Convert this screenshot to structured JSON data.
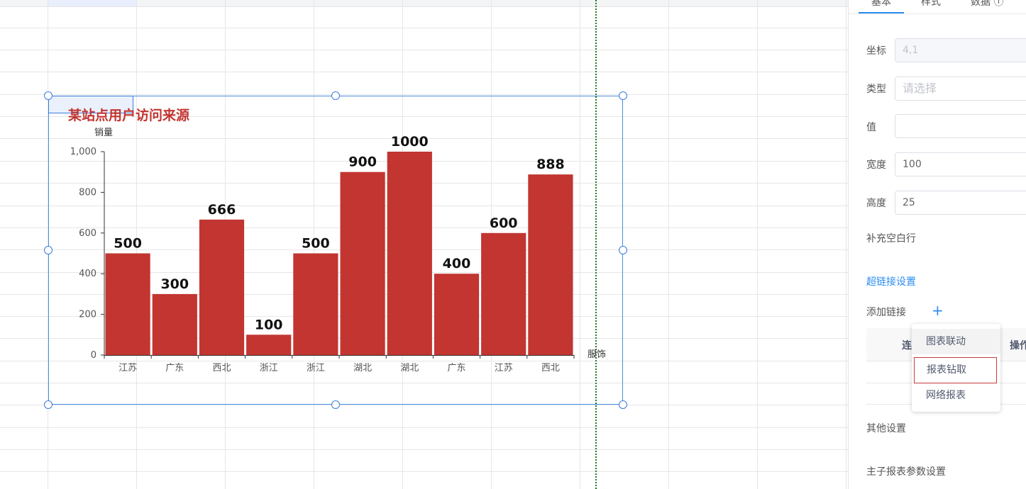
{
  "chart_data": {
    "type": "bar",
    "title": "某站点用户访问来源",
    "ylabel": "销量",
    "xlabel": "服饰",
    "categories": [
      "江苏",
      "广东",
      "西北",
      "浙江",
      "浙江",
      "湖北",
      "湖北",
      "广东",
      "江苏",
      "西北"
    ],
    "values": [
      500,
      300,
      666,
      100,
      500,
      900,
      1000,
      400,
      600,
      888
    ],
    "ylim": [
      0,
      1000
    ],
    "yticks": [
      "0",
      "200",
      "400",
      "600",
      "800",
      "1,000"
    ],
    "grid": false,
    "bar_color": "#c23531",
    "title_color": "#c23531"
  },
  "panel": {
    "tabs": [
      "基本",
      "样式",
      "数据 ⓘ"
    ],
    "coord_label": "坐标",
    "coord_value": "4,1",
    "type_label": "类型",
    "type_placeholder": "请选择",
    "value_label": "值",
    "width_label": "宽度",
    "width_value": "100",
    "height_label": "高度",
    "height_value": "25",
    "fill_blank_rows": "补充空白行",
    "hyperlink_settings": "超链接设置",
    "add_link": "添加链接",
    "add_link_icon": "plus-icon",
    "table_col_link": "连",
    "table_col_ops": "操作",
    "other_settings": "其他设置",
    "master_sub_params": "主子报表参数设置"
  },
  "dropdown": {
    "items": [
      "图表联动",
      "报表钻取",
      "网络报表"
    ],
    "accent_color": "#2d8cf0"
  }
}
